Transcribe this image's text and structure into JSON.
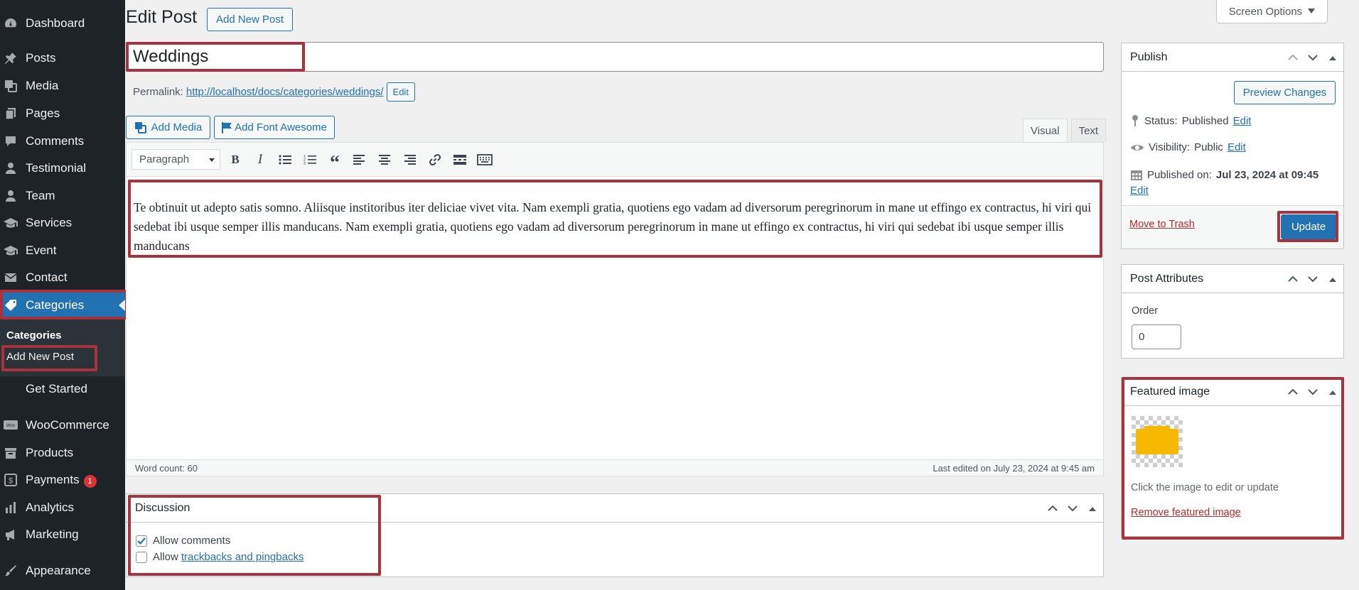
{
  "sidebar": {
    "items": [
      {
        "label": "Dashboard",
        "icon": "dashboard-icon"
      },
      {
        "label": "Posts",
        "icon": "pin-icon"
      },
      {
        "label": "Media",
        "icon": "media-icon"
      },
      {
        "label": "Pages",
        "icon": "pages-icon"
      },
      {
        "label": "Comments",
        "icon": "comments-icon"
      },
      {
        "label": "Testimonial",
        "icon": "person-icon"
      },
      {
        "label": "Team",
        "icon": "person-icon"
      },
      {
        "label": "Services",
        "icon": "education-icon"
      },
      {
        "label": "Event",
        "icon": "education-icon"
      },
      {
        "label": "Contact",
        "icon": "email-icon"
      },
      {
        "label": "Categories",
        "icon": "tag-icon"
      },
      {
        "label": "Get Started",
        "icon": ""
      },
      {
        "label": "WooCommerce",
        "icon": "woo-icon"
      },
      {
        "label": "Products",
        "icon": "archive-icon"
      },
      {
        "label": "Payments",
        "icon": "payments-icon",
        "badge": "1"
      },
      {
        "label": "Analytics",
        "icon": "chart-icon"
      },
      {
        "label": "Marketing",
        "icon": "megaphone-icon"
      },
      {
        "label": "Appearance",
        "icon": "brush-icon"
      }
    ],
    "submenu": {
      "current": "Categories",
      "add_new": "Add New Post"
    }
  },
  "header": {
    "title": "Edit Post",
    "add_new": "Add New Post",
    "screen_options": "Screen Options"
  },
  "post": {
    "title": "Weddings",
    "permalink_label": "Permalink:",
    "permalink_url": "http://localhost/docs/categories/weddings/",
    "permalink_edit": "Edit"
  },
  "editor": {
    "add_media": "Add Media",
    "add_font_awesome": "Add Font Awesome",
    "tab_visual": "Visual",
    "tab_text": "Text",
    "format": "Paragraph",
    "content": "Te obtinuit ut adepto satis somno. Aliisque institoribus iter deliciae vivet vita. Nam exempli gratia, quotiens ego vadam ad diversorum peregrinorum in mane ut effingo ex contractus, hi viri qui sedebat ibi usque semper illis manducans. Nam exempli gratia, quotiens ego vadam ad diversorum peregrinorum in mane ut effingo ex contractus, hi viri qui sedebat ibi usque semper illis manducans",
    "word_count": "Word count: 60",
    "last_edited": "Last edited on July 23, 2024 at 9:45 am"
  },
  "discussion": {
    "title": "Discussion",
    "allow_comments": "Allow comments",
    "allow_comments_checked": true,
    "allow_prefix": "Allow",
    "trackbacks_link": "trackbacks and pingbacks",
    "trackbacks_checked": false
  },
  "publish": {
    "title": "Publish",
    "preview": "Preview Changes",
    "status_label": "Status:",
    "status_value": "Published",
    "visibility_label": "Visibility:",
    "visibility_value": "Public",
    "published_label": "Published on:",
    "published_value": "Jul 23, 2024 at 09:45",
    "edit": "Edit",
    "trash": "Move to Trash",
    "update": "Update"
  },
  "attributes": {
    "title": "Post Attributes",
    "order_label": "Order",
    "order_value": "0"
  },
  "featured": {
    "title": "Featured image",
    "hint": "Click the image to edit or update",
    "remove": "Remove featured image"
  },
  "colors": {
    "accent": "#2271b1",
    "highlight": "#a8323d",
    "sidebar": "#1d2327"
  }
}
